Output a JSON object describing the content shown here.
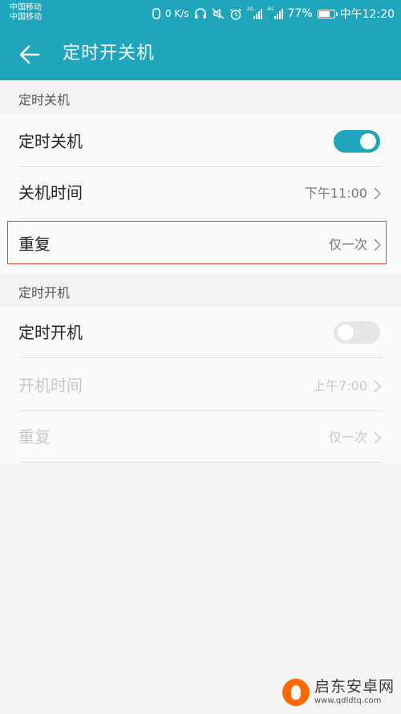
{
  "status_bar": {
    "carrier1": "中国移动",
    "carrier2": "中国移动",
    "speed": "0 K/s",
    "battery": "77%",
    "battery_level": 0.77,
    "time": "中午12:20",
    "icons": [
      "nfc-icon",
      "headset-icon",
      "mute-icon",
      "alarm-icon",
      "signal-2g-icon",
      "signal-4g-icon",
      "battery-icon"
    ],
    "net_labels": [
      "2G",
      "4G"
    ]
  },
  "toolbar": {
    "title": "定时开关机"
  },
  "sections": [
    {
      "header": "定时关机",
      "rows": [
        {
          "label": "定时关机",
          "toggle": true
        },
        {
          "label": "关机时间",
          "value": "下午11:00"
        },
        {
          "label": "重复",
          "value": "仅一次"
        }
      ]
    },
    {
      "header": "定时开机",
      "rows": [
        {
          "label": "定时开机",
          "toggle": false
        },
        {
          "label": "开机时间",
          "value": "上午7:00",
          "disabled": true
        },
        {
          "label": "重复",
          "value": "仅一次",
          "disabled": true
        }
      ]
    }
  ],
  "watermark": {
    "title": "启东安卓网",
    "url": "www.qdldtq.com"
  },
  "colors": {
    "accent": "#1fa6bd",
    "highlight": "#d9463a",
    "background": "#f4f4f4",
    "card": "#fafafa"
  }
}
